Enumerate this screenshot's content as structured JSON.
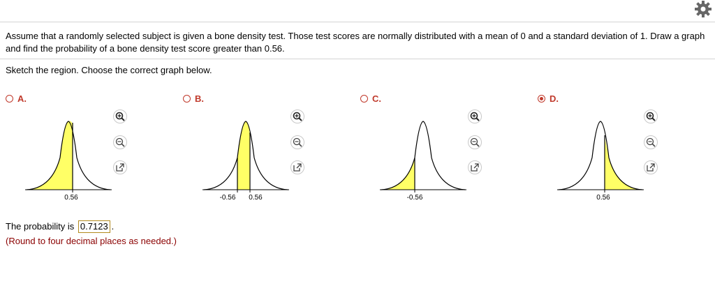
{
  "toolbar": {
    "settings_icon": "gear-icon"
  },
  "question": {
    "text": "Assume that a randomly selected subject is given a bone density test. Those test scores are normally distributed with a mean of 0 and a standard deviation of 1. Draw a graph and find the probability of a bone density test score greater than 0.56."
  },
  "instruction": "Sketch the region. Choose the correct graph below.",
  "colors": {
    "accent": "#c0392b",
    "shade": "#ffff66",
    "note": "#8b0000",
    "answer_border": "#b38a1e"
  },
  "options": [
    {
      "letter": "A.",
      "selected": false,
      "shaded": "left",
      "tick_labels": [
        "0.56"
      ],
      "tools": [
        "zoom-in-icon",
        "zoom-out-icon",
        "external-link-icon"
      ]
    },
    {
      "letter": "B.",
      "selected": false,
      "shaded": "middle",
      "tick_labels": [
        "-0.56",
        "0.56"
      ],
      "tools": [
        "zoom-in-icon",
        "zoom-out-icon",
        "external-link-icon"
      ]
    },
    {
      "letter": "C.",
      "selected": false,
      "shaded": "left",
      "tick_labels": [
        "-0.56"
      ],
      "tools": [
        "zoom-in-icon",
        "zoom-out-icon",
        "external-link-icon"
      ]
    },
    {
      "letter": "D.",
      "selected": true,
      "shaded": "right",
      "tick_labels": [
        "0.56"
      ],
      "tools": [
        "zoom-in-icon",
        "zoom-out-icon",
        "external-link-icon"
      ]
    }
  ],
  "answer": {
    "prefix": "The probability is",
    "value": "0.7123",
    "suffix": "."
  },
  "note": "(Round to four decimal places as needed.)"
}
